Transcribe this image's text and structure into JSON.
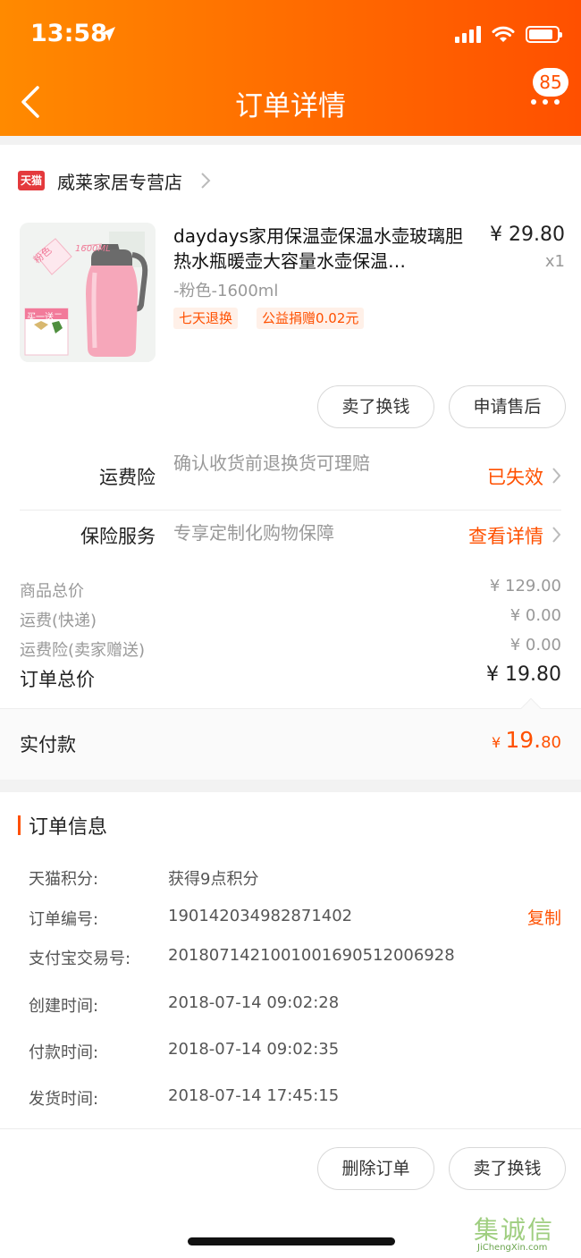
{
  "status_bar": {
    "time": "13:58"
  },
  "header": {
    "title": "订单详情",
    "badge_count": "85"
  },
  "shop": {
    "logo_text": "天猫",
    "name": "威莱家居专营店"
  },
  "product": {
    "image_caption": "1600ML",
    "image_color_tag": "粉色",
    "image_promo": "买一送二",
    "title": "daydays家用保温壶保温水壶玻璃胆热水瓶暖壶大容量水壶保温…",
    "sku": "-粉色-1600ml",
    "price": "¥ 29.80",
    "qty": "x1",
    "tags": [
      "七天退换",
      "公益捐赠0.02元"
    ]
  },
  "actions": {
    "sell": "卖了换钱",
    "after_sale": "申请售后"
  },
  "insurance": {
    "freight": {
      "label": "运费险",
      "desc": "确认收货前退换货可理赔",
      "status": "已失效"
    },
    "service": {
      "label": "保险服务",
      "desc": "专享定制化购物保障",
      "status": "查看详情"
    }
  },
  "summary": {
    "rows": [
      {
        "label": "商品总价",
        "value": "¥ 129.00"
      },
      {
        "label": "运费(快递)",
        "value": "¥ 0.00"
      },
      {
        "label": "运费险(卖家赠送)",
        "value": "¥ 0.00"
      }
    ],
    "total_label": "订单总价",
    "total_value": "¥ 19.80",
    "paid_label": "实付款",
    "paid_currency": "¥",
    "paid_int": "19.",
    "paid_dec": "80"
  },
  "order_info": {
    "title": "订单信息",
    "copy_label": "复制",
    "rows": [
      {
        "label": "天猫积分:",
        "value": "获得9点积分"
      },
      {
        "label": "订单编号:",
        "value": "190142034982871402"
      },
      {
        "label": "支付宝交易号:",
        "value": "2018071421001001690512006928"
      },
      {
        "label": "创建时间:",
        "value": "2018-07-14 09:02:28"
      },
      {
        "label": "付款时间:",
        "value": "2018-07-14 09:02:35"
      },
      {
        "label": "发货时间:",
        "value": "2018-07-14 17:45:15"
      }
    ]
  },
  "bottom_actions": {
    "delete": "删除订单",
    "sell": "卖了换钱"
  },
  "watermark": {
    "cn": "集诚信",
    "en": "JiChengXin.com"
  },
  "colors": {
    "accent": "#ff5000",
    "header_start": "#ff8a00",
    "header_end": "#ff5000"
  }
}
